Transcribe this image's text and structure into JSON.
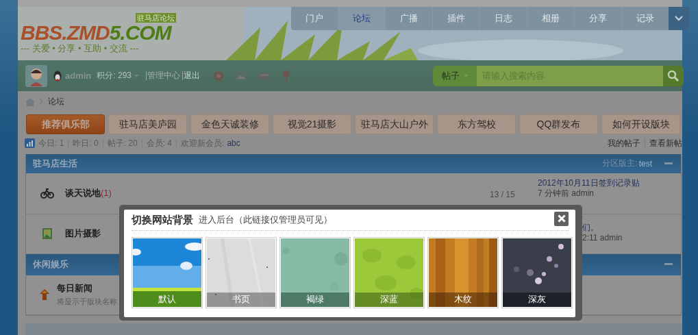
{
  "logo": {
    "brand": "BBS.ZMD",
    "brand_accent": "5.COM",
    "badge": "驻马店论坛",
    "slogan": "--- 关爱 • 分享 • 互助 • 交流 ---"
  },
  "nav": [
    {
      "label": "门户",
      "selected": false
    },
    {
      "label": "论坛",
      "selected": true
    },
    {
      "label": "广播",
      "selected": false
    },
    {
      "label": "插件",
      "selected": false
    },
    {
      "label": "日志",
      "selected": false
    },
    {
      "label": "相册",
      "selected": false
    },
    {
      "label": "分享",
      "selected": false
    },
    {
      "label": "记录",
      "selected": false
    }
  ],
  "user_bar": {
    "username": "admin",
    "points": "积分: 293",
    "links": [
      "管理中心",
      "退出"
    ]
  },
  "search": {
    "type": "帖子",
    "placeholder": "请输入搜索内容"
  },
  "breadcrumb": [
    "论坛"
  ],
  "club_tabs": [
    {
      "label": "推荐俱乐部",
      "selected": true
    },
    {
      "label": "驻马店美庐园",
      "selected": false
    },
    {
      "label": "金色天诚装修",
      "selected": false
    },
    {
      "label": "视觉21摄影",
      "selected": false
    },
    {
      "label": "驻马店大山户外",
      "selected": false
    },
    {
      "label": "东方驾校",
      "selected": false
    },
    {
      "label": "QQ群发布",
      "selected": false
    },
    {
      "label": "如何开设版块",
      "selected": false
    }
  ],
  "stats": {
    "items": [
      "今日: 1",
      "昨日: 0",
      "帖子: 20",
      "会员: 4"
    ],
    "welcome": "欢迎新会员:",
    "new_member": "abc",
    "links": [
      "我的帖子",
      "查看新帖"
    ]
  },
  "sections": [
    {
      "title": "驻马店生活",
      "moderator_label": "分区版主:",
      "moderator": "test",
      "forums": [
        {
          "name": "谈天说地",
          "new_count": "(1)",
          "counts": "13 / 15",
          "last_post": [
            "2012年10月11日签到记录贴",
            "7 分钟前 admin"
          ]
        },
        {
          "name": "图片摄影",
          "last_post": [
            "们。",
            "2:11 admin"
          ]
        }
      ]
    },
    {
      "title": "休闲娱乐",
      "forums": [
        {
          "name": "每日新闻",
          "description": "将显示于版块名称"
        }
      ]
    }
  ],
  "dialog": {
    "title": "切换网站背景",
    "link": "进入后台（此链接仅管理员可见）",
    "themes": [
      "默认",
      "书页",
      "褐绿",
      "深蓝",
      "木纹",
      "深灰"
    ]
  }
}
